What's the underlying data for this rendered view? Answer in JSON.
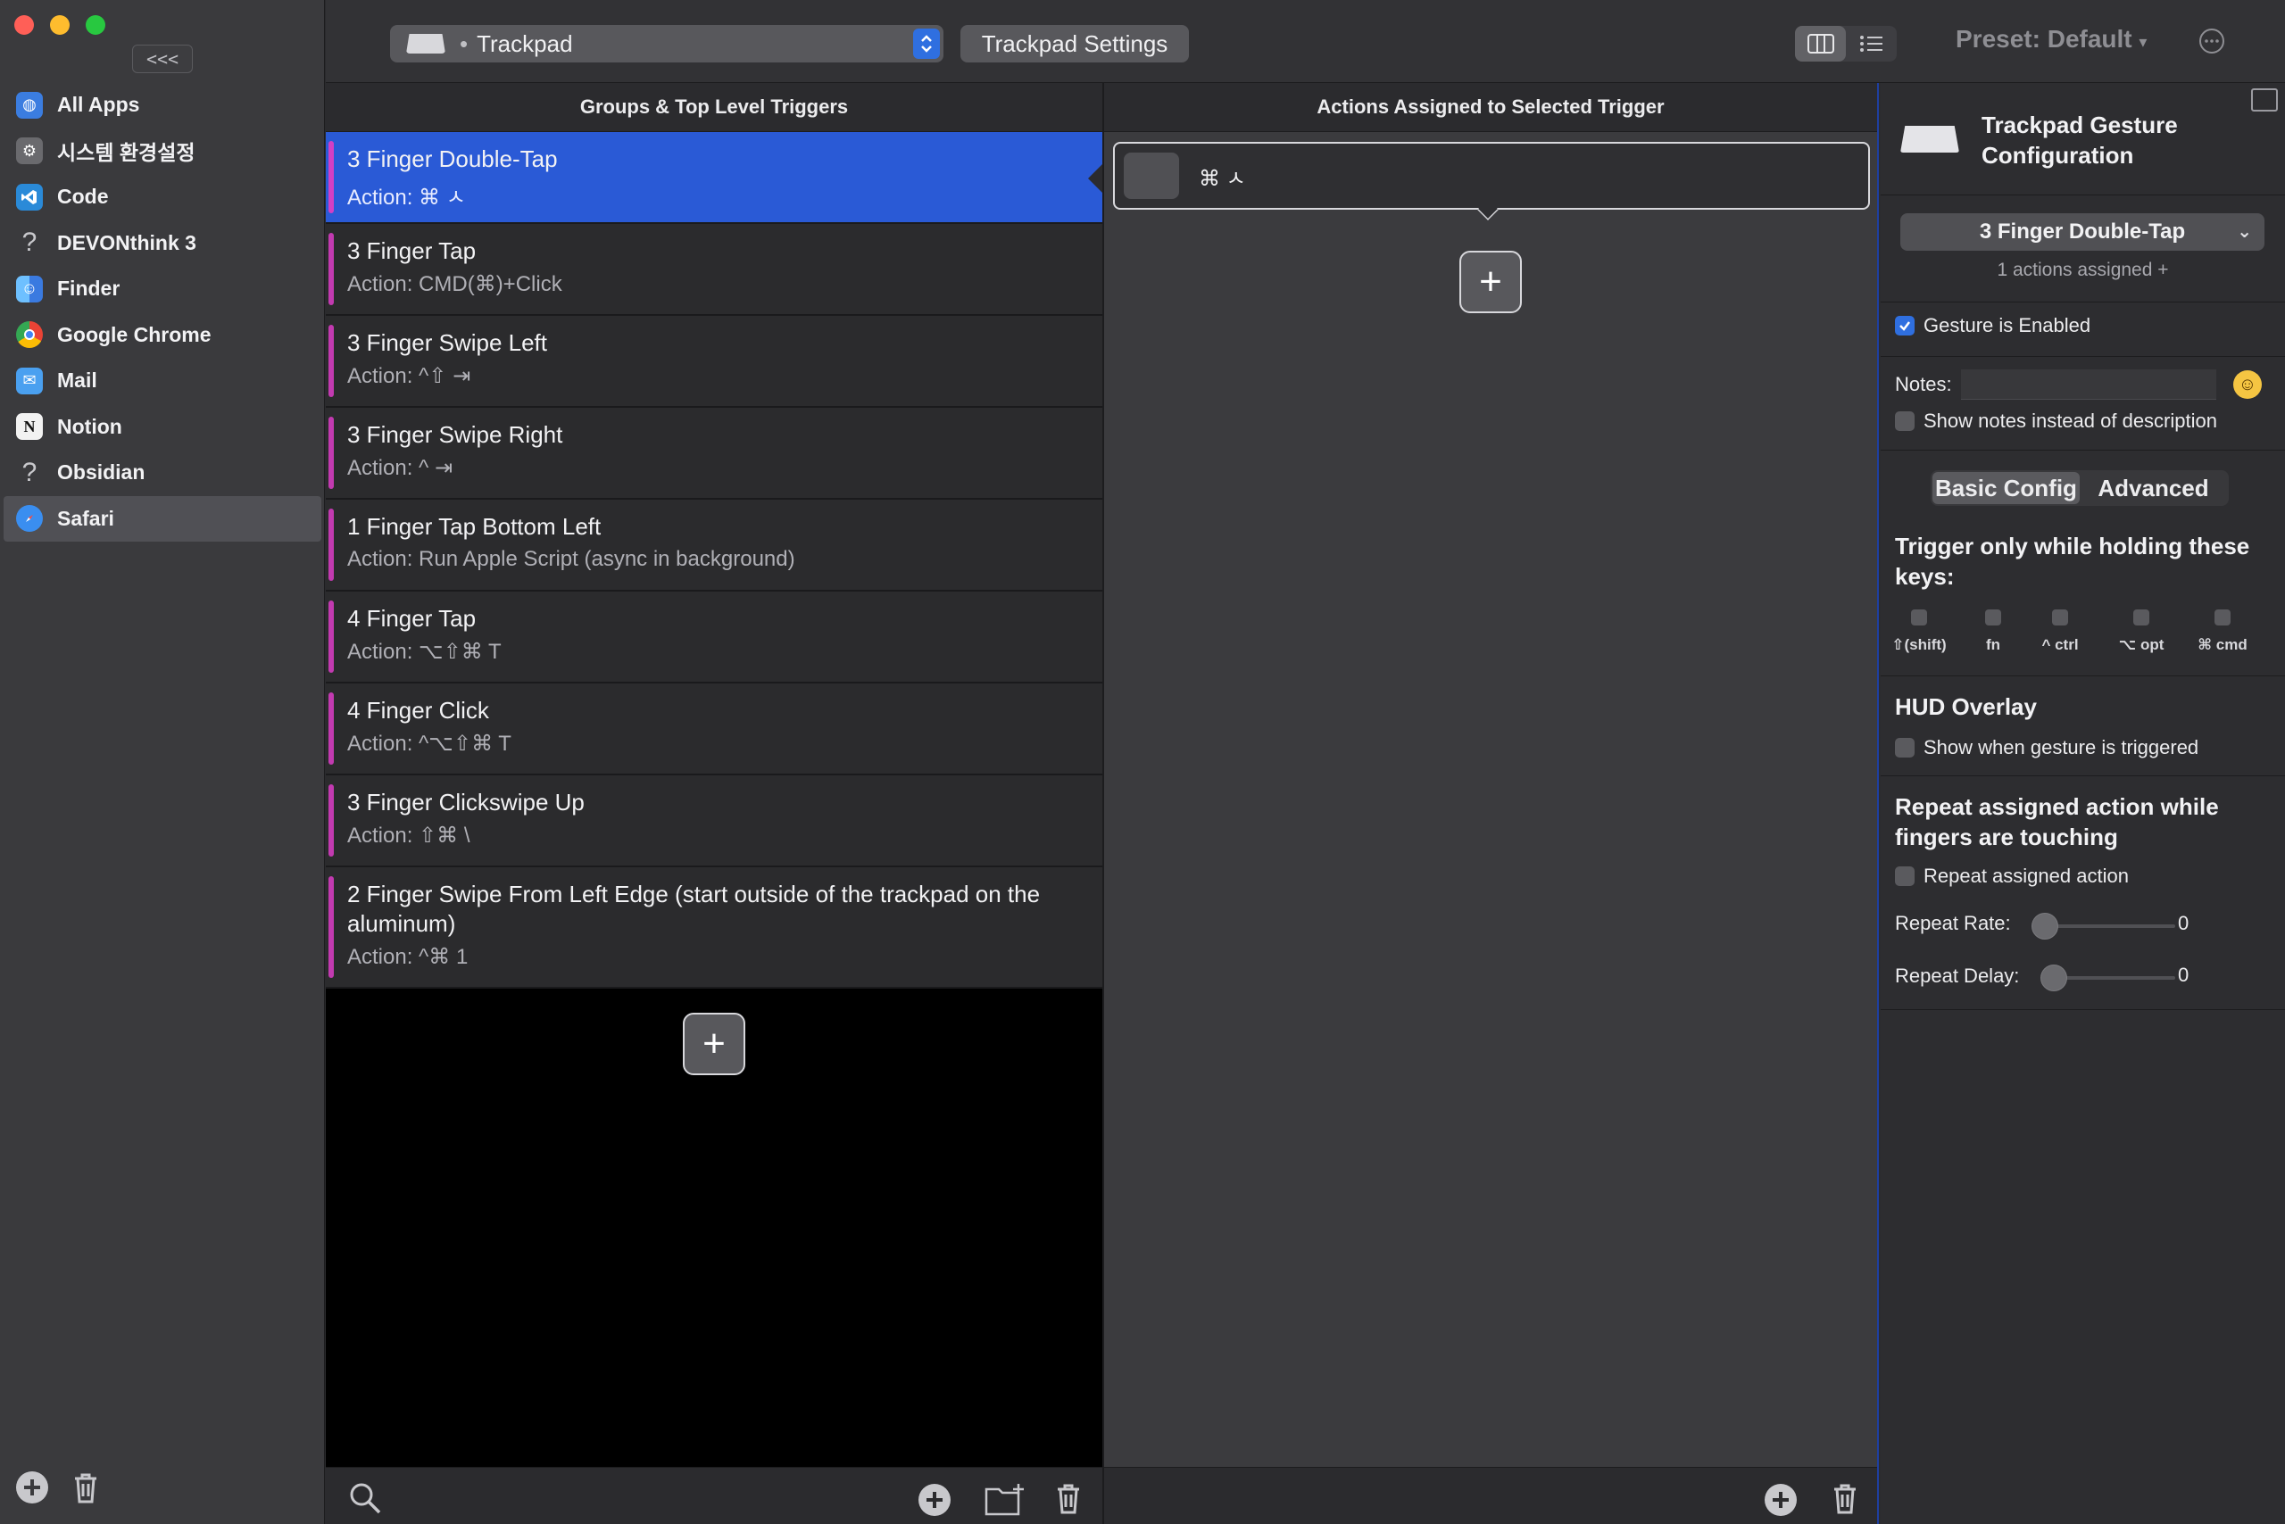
{
  "sidebar": {
    "collapse_label": "<<<",
    "apps": [
      {
        "name": "All Apps",
        "icon": "globe-icon",
        "color": "#3b7de0"
      },
      {
        "name": "시스템 환경설정",
        "icon": "gear-icon",
        "color": "#6a6a6e"
      },
      {
        "name": "Code",
        "icon": "vscode-icon",
        "color": "#2a8ad8"
      },
      {
        "name": "DEVONthink 3",
        "icon": "question-icon",
        "color": ""
      },
      {
        "name": "Finder",
        "icon": "finder-icon",
        "color": "#3a9af0"
      },
      {
        "name": "Google Chrome",
        "icon": "chrome-icon",
        "color": "#e4e4e4"
      },
      {
        "name": "Mail",
        "icon": "mail-icon",
        "color": "#4aa0f0"
      },
      {
        "name": "Notion",
        "icon": "notion-icon",
        "color": "#f2f2f2"
      },
      {
        "name": "Obsidian",
        "icon": "question-icon",
        "color": ""
      },
      {
        "name": "Safari",
        "icon": "safari-icon",
        "color": "#3a8ef0",
        "selected": true
      }
    ]
  },
  "toolbar": {
    "trigger_type": "Trackpad",
    "settings_label": "Trackpad Settings",
    "preset_label": "Preset: Default"
  },
  "triggers": {
    "header": "Groups & Top Level Triggers",
    "items": [
      {
        "title": "3 Finger Double-Tap",
        "action": "Action: ⌘ ㅅ",
        "selected": true
      },
      {
        "title": "3 Finger Tap",
        "action": "Action: CMD(⌘)+Click"
      },
      {
        "title": "3 Finger Swipe Left",
        "action": "Action: ^⇧ ⇥"
      },
      {
        "title": "3 Finger Swipe Right",
        "action": "Action: ^ ⇥"
      },
      {
        "title": "1 Finger Tap Bottom Left",
        "action": "Action: Run Apple Script (async in background)"
      },
      {
        "title": "4 Finger Tap",
        "action": "Action: ⌥⇧⌘ T"
      },
      {
        "title": "4 Finger Click",
        "action": "Action: ^⌥⇧⌘ T"
      },
      {
        "title": "3 Finger Clickswipe Up",
        "action": "Action: ⇧⌘ \\"
      },
      {
        "title": "2 Finger Swipe From Left Edge (start outside of the trackpad on the aluminum)",
        "action": "Action: ^⌘ 1"
      }
    ]
  },
  "actions": {
    "header": "Actions Assigned to Selected Trigger",
    "items": [
      {
        "keys": "⌘ ㅅ"
      }
    ]
  },
  "config": {
    "title": "Trackpad Gesture Configuration",
    "selected_gesture": "3 Finger Double-Tap",
    "assigned_count": "1 actions assigned +",
    "enabled_label": "Gesture is Enabled",
    "enabled": true,
    "notes_label": "Notes:",
    "notes_value": "",
    "show_notes_label": "Show notes instead of description",
    "tabs": [
      "Basic Config",
      "Advanced"
    ],
    "active_tab": "Basic Config",
    "modifier_heading": "Trigger only while holding these keys:",
    "modifiers": [
      "⇧(shift)",
      "fn",
      "^ ctrl",
      "⌥ opt",
      "⌘ cmd"
    ],
    "hud_heading": "HUD Overlay",
    "hud_label": "Show when gesture is triggered",
    "repeat_heading": "Repeat assigned action while fingers are touching",
    "repeat_label": "Repeat assigned action",
    "repeat_rate_label": "Repeat Rate:",
    "repeat_rate_value": "0",
    "repeat_delay_label": "Repeat Delay:",
    "repeat_delay_value": "0"
  }
}
